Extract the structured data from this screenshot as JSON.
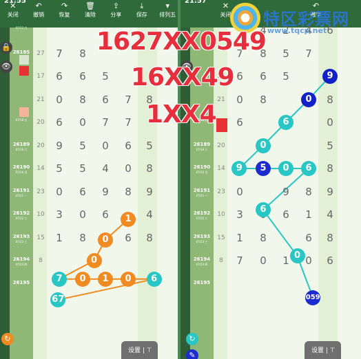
{
  "left": {
    "status_time": "21:55",
    "toolbar": [
      {
        "icon": "close-icon",
        "glyph": "✕",
        "label": "关闭"
      },
      {
        "icon": "undo-icon",
        "glyph": "↶",
        "label": "撤销"
      },
      {
        "icon": "redo-icon",
        "glyph": "↷",
        "label": "恢复"
      },
      {
        "icon": "trash-icon",
        "glyph": "🗑",
        "label": "清除"
      },
      {
        "icon": "share-icon",
        "glyph": "⇪",
        "label": "分享"
      },
      {
        "icon": "save-icon",
        "glyph": "⤓",
        "label": "保存"
      },
      {
        "icon": "filter-icon",
        "glyph": "▾",
        "label": "排列五"
      }
    ],
    "issues": [
      {
        "no": "",
        "date": "07/13 六"
      },
      {
        "no": "26185",
        "date": ""
      },
      {
        "no": "",
        "date": ""
      },
      {
        "no": "",
        "date": ""
      },
      {
        "no": "",
        "date": "07/18 五"
      },
      {
        "no": "26189",
        "date": "07/19 六"
      },
      {
        "no": "26190",
        "date": "07/20 日"
      },
      {
        "no": "26191",
        "date": "07/21 一"
      },
      {
        "no": "26192",
        "date": "07/22 二"
      },
      {
        "no": "26193",
        "date": "07/23 三"
      },
      {
        "no": "26194",
        "date": "07/23 四"
      },
      {
        "no": "26195",
        "date": ""
      }
    ],
    "rownums": [
      "",
      "27",
      "17",
      "21",
      "20",
      "20",
      "14",
      "23",
      "10",
      "15",
      "8",
      ""
    ],
    "rows": [
      [
        "",
        "",
        "",
        "",
        ""
      ],
      [
        "7",
        "8",
        "",
        "",
        ""
      ],
      [
        "6",
        "6",
        "5",
        "",
        ""
      ],
      [
        "0",
        "8",
        "6",
        "7",
        "8"
      ],
      [
        "6",
        "0",
        "7",
        "7",
        ""
      ],
      [
        "9",
        "5",
        "0",
        "6",
        "5"
      ],
      [
        "5",
        "5",
        "4",
        "0",
        "8"
      ],
      [
        "0",
        "6",
        "9",
        "8",
        "9"
      ],
      [
        "3",
        "0",
        "6",
        "",
        "4"
      ],
      [
        "1",
        "8",
        "",
        "6",
        "8"
      ],
      [
        "",
        "",
        "",
        "",
        ""
      ],
      [
        "",
        "",
        "",
        "",
        ""
      ]
    ],
    "circles": [
      {
        "value": "1",
        "color": "orange"
      },
      {
        "value": "0",
        "color": "orange"
      },
      {
        "value": "0",
        "color": "orange"
      },
      {
        "value": "7",
        "color": "cyan"
      },
      {
        "value": "0",
        "color": "orange"
      },
      {
        "value": "1",
        "color": "orange"
      },
      {
        "value": "0",
        "color": "orange"
      },
      {
        "value": "6",
        "color": "cyan"
      },
      {
        "value": "67",
        "color": "cyan"
      }
    ],
    "settings_label": "设置"
  },
  "right": {
    "status_time": "21:57",
    "toolbar": [
      {
        "icon": "close-icon",
        "glyph": "✕",
        "label": "关闭"
      },
      {
        "icon": "undo-icon",
        "glyph": "↶",
        "label": "撤销"
      }
    ],
    "issues": [
      {
        "no": "",
        "date": ""
      },
      {
        "no": "",
        "date": ""
      },
      {
        "no": "",
        "date": ""
      },
      {
        "no": "",
        "date": ""
      },
      {
        "no": "",
        "date": "07/18 五"
      },
      {
        "no": "26189",
        "date": "07/19 六"
      },
      {
        "no": "26190",
        "date": "07/20 日"
      },
      {
        "no": "26191",
        "date": "07/21 一"
      },
      {
        "no": "26192",
        "date": "07/22 二"
      },
      {
        "no": "26193",
        "date": "07/23 三"
      },
      {
        "no": "26194",
        "date": "07/23 四"
      },
      {
        "no": "26195",
        "date": ""
      }
    ],
    "rownums": [
      "",
      "",
      "17",
      "21",
      "20",
      "20",
      "14",
      "23",
      "10",
      "15",
      "8",
      ""
    ],
    "rows": [
      [
        "",
        "4",
        "2",
        "4",
        "6"
      ],
      [
        "7",
        "8",
        "5",
        "7",
        ""
      ],
      [
        "6",
        "6",
        "5",
        "",
        "1"
      ],
      [
        "0",
        "8",
        "",
        "7",
        "8"
      ],
      [
        "6",
        "",
        "7",
        "",
        "0"
      ],
      [
        "",
        "",
        "",
        "",
        "5"
      ],
      [
        "5",
        "5",
        "4",
        "0",
        "8"
      ],
      [
        "0",
        "",
        "9",
        "8",
        "9"
      ],
      [
        "3",
        "0",
        "6",
        "1",
        "4"
      ],
      [
        "1",
        "8",
        "",
        "6",
        "8"
      ],
      [
        "7",
        "0",
        "1",
        "0",
        "6"
      ],
      [
        "",
        "",
        "",
        "",
        ""
      ]
    ],
    "circles": [
      {
        "value": "9",
        "color": "blue"
      },
      {
        "value": "0",
        "color": "blue"
      },
      {
        "value": "6",
        "color": "cyan"
      },
      {
        "value": "0",
        "color": "cyan"
      },
      {
        "value": "9",
        "color": "cyan"
      },
      {
        "value": "5",
        "color": "navy"
      },
      {
        "value": "0",
        "color": "cyan"
      },
      {
        "value": "6",
        "color": "cyan"
      },
      {
        "value": "6",
        "color": "cyan"
      },
      {
        "value": "0",
        "color": "cyan"
      },
      {
        "value": "059",
        "color": "navy"
      }
    ],
    "settings_label": "设置"
  },
  "overlay": {
    "line1": "1627XX0549",
    "line2": "16XX49",
    "line3": "1XX4"
  },
  "watermark": {
    "brand": "特区彩票网",
    "url": "www.tqcp.net"
  },
  "colors": {
    "orange": "#f28a22",
    "cyan": "#28c6c4",
    "blue": "#1320c8",
    "navy": "#1d2ccf",
    "overlay_red": "#e62f3c",
    "toolbar_green": "#2f6a3a"
  }
}
